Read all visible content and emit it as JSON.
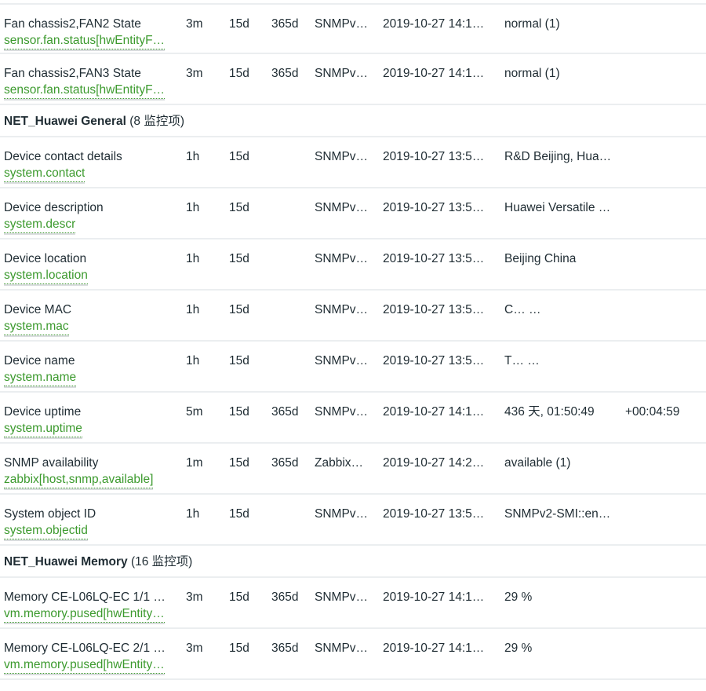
{
  "rows": [
    {
      "kind": "item",
      "name": "Fan chassis2,FAN2 State",
      "key": "sensor.fan.status[hwEntityF…",
      "interval": "3m",
      "history": "15d",
      "trends": "365d",
      "type": "SNMPv…",
      "lastcheck": "2019-10-27 14:1…",
      "lastvalue": "normal (1)",
      "change": ""
    },
    {
      "kind": "item",
      "name": "Fan chassis2,FAN3 State",
      "key": "sensor.fan.status[hwEntityF…",
      "interval": "3m",
      "history": "15d",
      "trends": "365d",
      "type": "SNMPv…",
      "lastcheck": "2019-10-27 14:1…",
      "lastvalue": "normal (1)",
      "change": ""
    },
    {
      "kind": "group",
      "name": "NET_Huawei General",
      "count": "(8 监控项)"
    },
    {
      "kind": "item",
      "name": "Device contact details",
      "key": "system.contact",
      "interval": "1h",
      "history": "15d",
      "trends": "",
      "type": "SNMPv…",
      "lastcheck": "2019-10-27 13:5…",
      "lastvalue": "R&D Beijing, Hua…",
      "change": ""
    },
    {
      "kind": "item",
      "name": "Device description",
      "key": "system.descr",
      "interval": "1h",
      "history": "15d",
      "trends": "",
      "type": "SNMPv…",
      "lastcheck": "2019-10-27 13:5…",
      "lastvalue": "Huawei Versatile …",
      "change": ""
    },
    {
      "kind": "item",
      "name": "Device location",
      "key": "system.location",
      "interval": "1h",
      "history": "15d",
      "trends": "",
      "type": "SNMPv…",
      "lastcheck": "2019-10-27 13:5…",
      "lastvalue": "Beijing China",
      "change": ""
    },
    {
      "kind": "item",
      "name": "Device MAC",
      "key": "system.mac",
      "interval": "1h",
      "history": "15d",
      "trends": "",
      "type": "SNMPv…",
      "lastcheck": "2019-10-27 13:5…",
      "lastvalue": "C…                    …",
      "change": ""
    },
    {
      "kind": "item",
      "name": "Device name",
      "key": "system.name",
      "interval": "1h",
      "history": "15d",
      "trends": "",
      "type": "SNMPv…",
      "lastcheck": "2019-10-27 13:5…",
      "lastvalue": "T…                    …",
      "change": ""
    },
    {
      "kind": "item",
      "name": "Device uptime",
      "key": "system.uptime",
      "interval": "5m",
      "history": "15d",
      "trends": "365d",
      "type": "SNMPv…",
      "lastcheck": "2019-10-27 14:1…",
      "lastvalue": "436 天, 01:50:49",
      "change": "+00:04:59"
    },
    {
      "kind": "item",
      "name": "SNMP availability",
      "key": "zabbix[host,snmp,available]",
      "interval": "1m",
      "history": "15d",
      "trends": "365d",
      "type": "Zabbix…",
      "lastcheck": "2019-10-27 14:2…",
      "lastvalue": "available (1)",
      "change": ""
    },
    {
      "kind": "item",
      "name": "System object ID",
      "key": "system.objectid",
      "interval": "1h",
      "history": "15d",
      "trends": "",
      "type": "SNMPv…",
      "lastcheck": "2019-10-27 13:5…",
      "lastvalue": "SNMPv2-SMI::en…",
      "change": ""
    },
    {
      "kind": "group",
      "name": "NET_Huawei Memory",
      "count": "(16 监控项)"
    },
    {
      "kind": "item",
      "name": "Memory CE-L06LQ-EC 1/1 …",
      "key": "vm.memory.pused[hwEntity…",
      "interval": "3m",
      "history": "15d",
      "trends": "365d",
      "type": "SNMPv…",
      "lastcheck": "2019-10-27 14:1…",
      "lastvalue": "29 %",
      "change": ""
    },
    {
      "kind": "item",
      "name": "Memory CE-L06LQ-EC 2/1 …",
      "key": "vm.memory.pused[hwEntity…",
      "interval": "3m",
      "history": "15d",
      "trends": "365d",
      "type": "SNMPv…",
      "lastcheck": "2019-10-27 14:1…",
      "lastvalue": "29 %",
      "change": ""
    }
  ]
}
